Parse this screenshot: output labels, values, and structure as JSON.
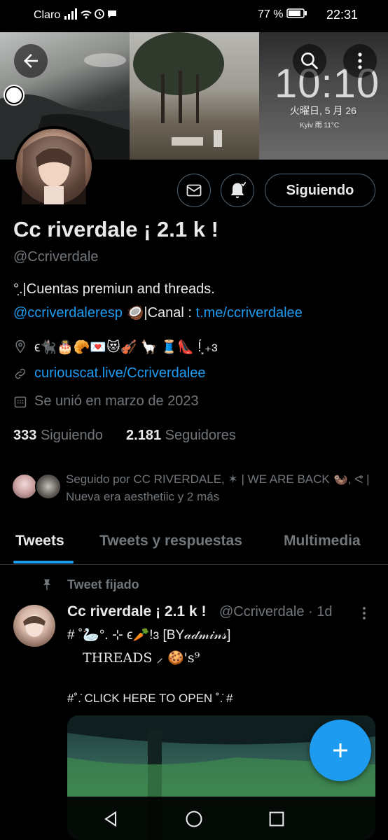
{
  "status_bar": {
    "carrier": "Claro",
    "signal": "▐▐▐▐",
    "battery_pct": "77 %",
    "time": "22:31"
  },
  "banner": {
    "lock_time": "10:10",
    "lock_date": "火曜日, 5 月 26",
    "lock_weather": "Kyiv  雨  11°C"
  },
  "profile": {
    "name": "Cc riverdale ¡ 2.1 k !",
    "handle": "@Ccriverdale",
    "bio_line1": "°.̣|Cuentas premiun and threads.",
    "bio_mention": "@ccriverdaleresp",
    "bio_mid": " 🥥|Canal : ",
    "bio_link": "t.me/ccriverdalee",
    "location": "ϵ🐈‍⬛🎂🥐💌😻🎻 🦙  🧵👠 !́⸼₊ɜ",
    "website": "curiouscat.live/Ccriverdalee",
    "joined": "Se unió en marzo de 2023",
    "following_count": "333",
    "following_label": "Siguiendo",
    "followers_count": "2.181",
    "followers_label": "Seguidores",
    "followed_by": "Seguido por CC RIVERDALE, ✶ | WE ARE BACK 🦦, ᕙ | Nueva era aesthetiic y 2 más",
    "follow_button": "Siguiendo"
  },
  "tabs": [
    {
      "label": "Tweets",
      "active": true
    },
    {
      "label": "Tweets y respuestas",
      "active": false
    },
    {
      "label": "Multimedia",
      "active": false
    }
  ],
  "tweet": {
    "pinned_label": "Tweet fijado",
    "author_name": "Cc riverdale ¡ 2.1 k !",
    "author_meta": "@Ccriverdale · 1d",
    "line1": "# ˚🦢°. ⊹ ϵ🥕!ɜ [BY𝒶𝒹𝓂𝒾𝓃𝓈]",
    "line2": "THREADS  ⸝ 🍪's⁹",
    "line3": "#˚.̇ CLICK HERE TO OPEN ˚.̇ #"
  },
  "colors": {
    "accent": "#1d9bf0",
    "background": "#000000",
    "muted": "#71767b"
  },
  "icons": [
    "back-arrow-icon",
    "search-icon",
    "more-vertical-icon",
    "mail-icon",
    "bell-icon",
    "location-icon",
    "link-icon",
    "calendar-icon",
    "pin-icon",
    "plus-icon",
    "nav-back-icon",
    "nav-home-icon",
    "nav-recents-icon"
  ]
}
